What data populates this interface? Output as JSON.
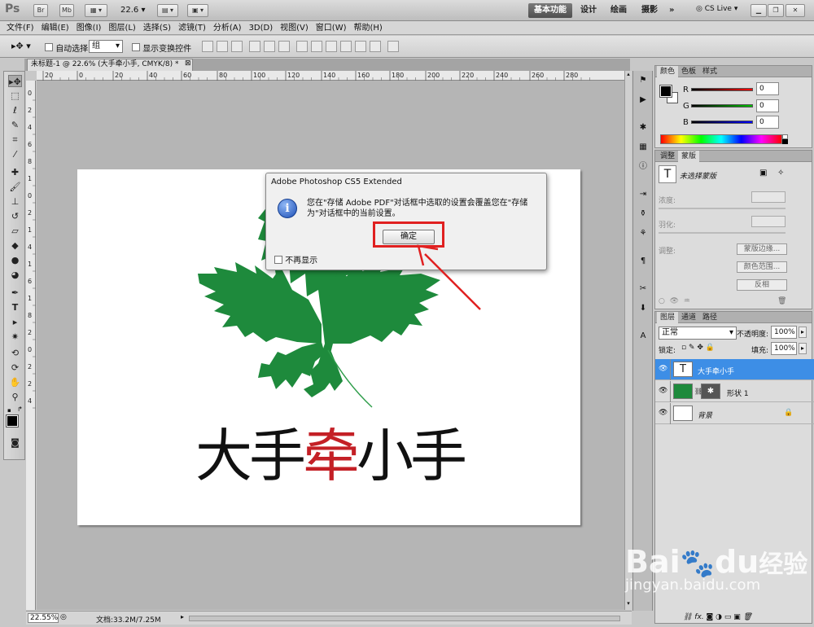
{
  "appbar": {
    "logo": "Ps",
    "btn_br": "Br",
    "btn_mb": "Mb",
    "zoom": "22.6",
    "workspaces": [
      "基本功能",
      "设计",
      "绘画",
      "摄影"
    ],
    "more": "»",
    "cslive": "CS Live"
  },
  "menu": [
    "文件(F)",
    "编辑(E)",
    "图像(I)",
    "图层(L)",
    "选择(S)",
    "滤镜(T)",
    "分析(A)",
    "3D(D)",
    "视图(V)",
    "窗口(W)",
    "帮助(H)"
  ],
  "options": {
    "auto_select": "自动选择:",
    "auto_select_value": "组",
    "show_transform": "显示变换控件"
  },
  "document": {
    "tab_label": "未标题-1 @ 22.6% (大手牵小手, CMYK/8) *",
    "ruler_top_ticks": [
      "20",
      "0",
      "20",
      "40",
      "60",
      "80",
      "100",
      "120",
      "140",
      "160",
      "180",
      "200",
      "220",
      "240",
      "260",
      "280"
    ],
    "ruler_left_ticks": [
      "0",
      "2",
      "4",
      "6",
      "8",
      "1",
      "0",
      "2",
      "1",
      "4",
      "1",
      "6",
      "1",
      "8",
      "2",
      "0",
      "2",
      "2",
      "4"
    ],
    "logo_text_a": "大手",
    "logo_text_b": "牵",
    "logo_text_c": "小手"
  },
  "status": {
    "zoom": "22.55%",
    "doc_info": "文档:33.2M/7.25M"
  },
  "dialog": {
    "title": "Adobe Photoshop CS5 Extended",
    "message": "您在\"存储 Adobe PDF\"对话框中选取的设置会覆盖您在\"存储为\"对话框中的当前设置。",
    "ok": "确定",
    "dont_show": "不再显示"
  },
  "color_panel": {
    "tabs": [
      "颜色",
      "色板",
      "样式"
    ],
    "r_label": "R",
    "g_label": "G",
    "b_label": "B",
    "r": "0",
    "g": "0",
    "b": "0"
  },
  "adjust_panel": {
    "tabs": [
      "调整",
      "蒙版"
    ],
    "no_mask": "未选择蒙版",
    "density": "浓度:",
    "feather": "羽化:",
    "refine": "调整:",
    "mask_edge": "蒙版边缘...",
    "color_range": "颜色范围...",
    "invert": "反相"
  },
  "layers_panel": {
    "tabs": [
      "图层",
      "通道",
      "路径"
    ],
    "blend": "正常",
    "opacity_label": "不透明度:",
    "opacity": "100%",
    "lock_label": "锁定:",
    "fill_label": "填充:",
    "fill": "100%",
    "layers": [
      {
        "name": "大手牵小手",
        "thumb": "T"
      },
      {
        "name": "形状 1",
        "thumb": ""
      },
      {
        "name": "背景",
        "thumb": ""
      }
    ],
    "bottom_icons": "fx."
  },
  "watermark": {
    "line1": "Bai",
    "line2": "du",
    "line3": "经验",
    "url": "jingyan.baidu.com"
  },
  "colors": {
    "accent_red": "#e02020",
    "leaf_green": "#1e8a3c",
    "logo_red": "#c42026",
    "layer_selected": "#3d8ee6"
  }
}
